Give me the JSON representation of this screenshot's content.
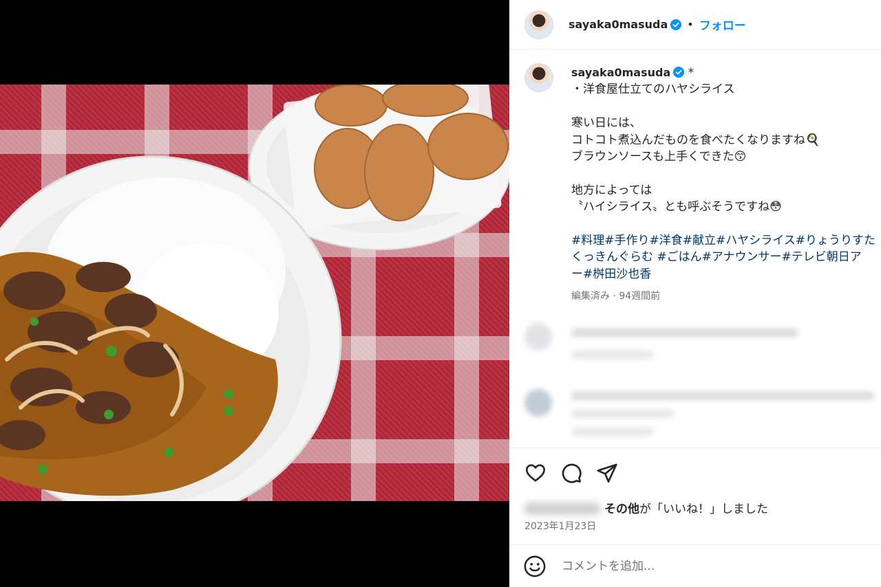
{
  "post": {
    "username": "sayaka0masuda",
    "header_separator": "•",
    "follow_label": "フォロー",
    "caption_title_marker": "*",
    "caption_lines": [
      "・洋食屋仕立てのハヤシライス",
      "",
      "寒い日には、",
      "コトコト煮込んだものを食べたくなりますね🍳",
      "ブラウンソースも上手くできた😙",
      "",
      "地方によっては",
      "〝ハイシライス〟とも呼ぶそうですね😳",
      ""
    ],
    "hashtag_lines": [
      "#料理#手作り#洋食#献立#ハヤシライス#りょうりすた",
      "くっきんぐらむ #ごはん#アナウンサー#テレビ朝日ア",
      "ー#桝田沙也香"
    ],
    "caption_meta": "編集済み · 94週間前",
    "likes_text_bold": "その他",
    "likes_text_rest": "が「いいね！」しました",
    "date": "2023年1月23日",
    "comment_placeholder": "コメントを追加..."
  },
  "icons": {
    "verified": "verified-badge-icon",
    "like": "heart-icon",
    "comment": "comment-bubble-icon",
    "share": "paper-plane-icon",
    "emoji": "smiley-icon"
  },
  "colors": {
    "follow": "#0095f6",
    "hashtag": "#00376b",
    "verified": "#0095f6",
    "meta": "#737373"
  }
}
